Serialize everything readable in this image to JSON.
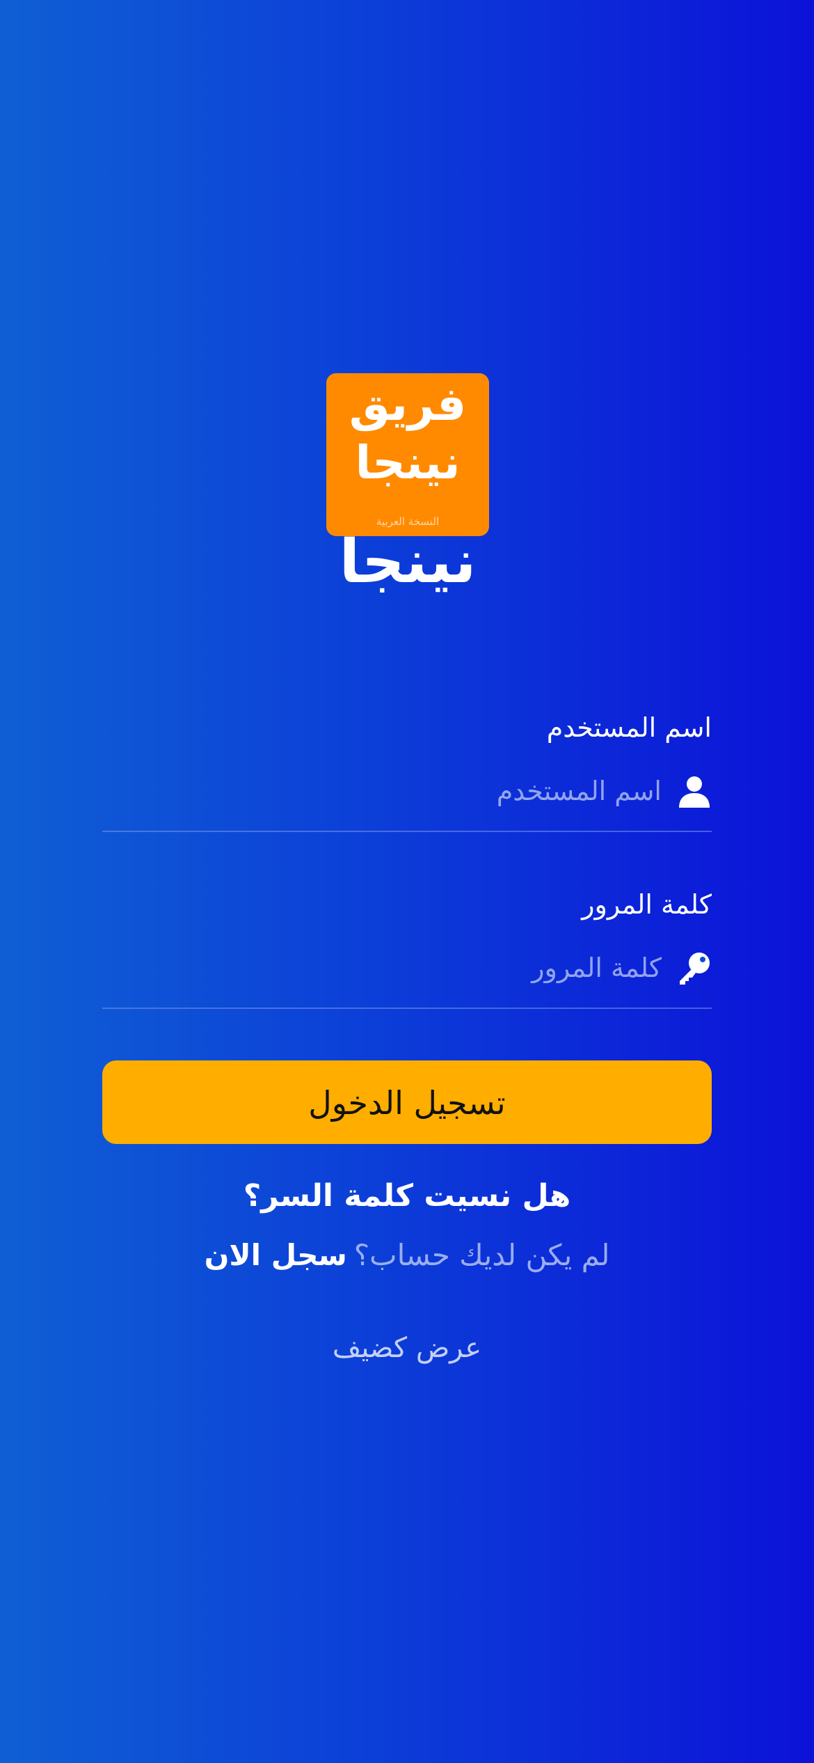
{
  "logo": {
    "box_line1": "فريق",
    "box_line2": "نينجا",
    "box_subtitle": "النسخة العربية",
    "wordmark": "نينجا"
  },
  "username": {
    "label": "اسم المستخدم",
    "placeholder": "اسم المستخدم",
    "value": "",
    "icon": "person-icon"
  },
  "password": {
    "label": "كلمة المرور",
    "placeholder": "كلمة المرور",
    "value": "",
    "icon": "key-icon"
  },
  "login_button": {
    "label": "تسجيل الدخول"
  },
  "forgot_password": "هل نسيت كلمة السر؟",
  "register": {
    "question": "لم يكن لديك حساب؟",
    "link": "سجل الان"
  },
  "guest_link": "عرض كضيف",
  "colors": {
    "background_start": "#0f5fd4",
    "background_end": "#0c12d8",
    "logo_orange": "#ff8a00",
    "button_yellow": "#ffae00",
    "text_white": "#ffffff"
  }
}
